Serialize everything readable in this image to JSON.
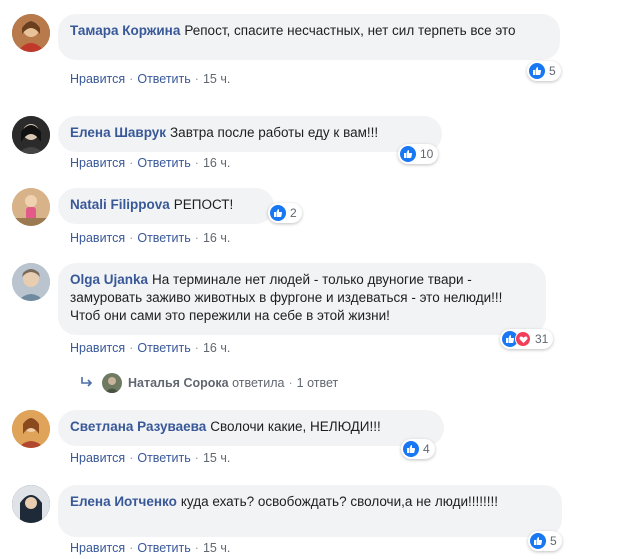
{
  "comments": [
    {
      "author": "Тамара Коржина",
      "text": "Репост, спасите несчастных, нет сил терпеть все это",
      "like": "Нравится",
      "reply": "Ответить",
      "time": "15 ч.",
      "reactions": "5"
    },
    {
      "author": "Елена Шаврук",
      "text": "Завтра после работы еду к вам!!!",
      "like": "Нравится",
      "reply": "Ответить",
      "time": "16 ч.",
      "reactions": "10"
    },
    {
      "author": "Natali Filippova",
      "text": "РЕПОСТ!",
      "like": "Нравится",
      "reply": "Ответить",
      "time": "16 ч.",
      "reactions": "2"
    },
    {
      "author": "Olga Ujanka",
      "text": "На терминале нет людей - только двуногие твари - замуровать заживо животных в фургоне и издеваться - это нелюди!!! Чтоб они сами это пережили на себе в этой жизни!",
      "like": "Нравится",
      "reply": "Ответить",
      "time": "16 ч.",
      "reactions": "31"
    },
    {
      "author": "Светлана Разуваева",
      "text": "Сволочи какие, НЕЛЮДИ!!!",
      "like": "Нравится",
      "reply": "Ответить",
      "time": "15 ч.",
      "reactions": "4"
    },
    {
      "author": "Елена Иотченко",
      "text": "куда ехать? освобождать? сволочи,а не люди!!!!!!!!",
      "like": "Нравится",
      "reply": "Ответить",
      "time": "15 ч.",
      "reactions": "5"
    }
  ],
  "reply_thread": {
    "name": "Наталья Сорока",
    "action": "ответила",
    "count": "1 ответ"
  },
  "colors": {
    "link": "#385898",
    "bubble": "#f2f3f5",
    "like": "#1877f2",
    "love": "#f33e58"
  },
  "icons": {
    "like": "thumbs-up-icon",
    "love": "heart-icon",
    "reply_arrow": "reply-arrow-icon"
  }
}
